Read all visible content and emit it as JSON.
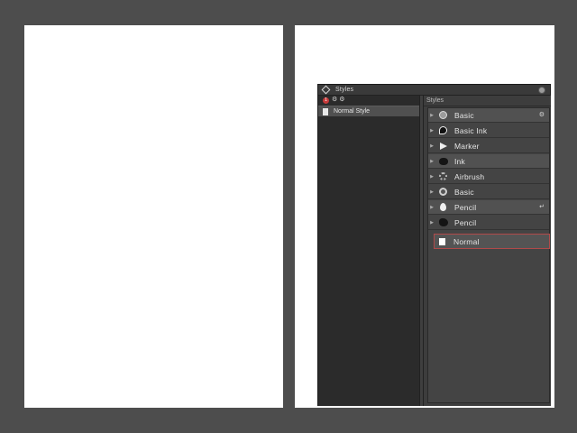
{
  "panel": {
    "title": "Styles",
    "toolbar": {
      "badge": "1",
      "tools": "⚙ ⚙"
    },
    "left_items": [
      {
        "label": "Normal Style"
      }
    ],
    "right_header": "Styles",
    "items": [
      {
        "label": "Basic",
        "icon": "circle-icon",
        "trail": "⚙"
      },
      {
        "label": "Basic Ink",
        "icon": "ink-blob-icon"
      },
      {
        "label": "Marker",
        "icon": "marker-icon"
      },
      {
        "label": "Ink",
        "icon": "ink-icon"
      },
      {
        "label": "Airbrush",
        "icon": "airbrush-icon"
      },
      {
        "label": "Basic",
        "icon": "ring-icon"
      },
      {
        "label": "Pencil",
        "icon": "pencil-icon",
        "trail": "↵"
      },
      {
        "label": "Pencil",
        "icon": "pencil-dark-icon"
      },
      {
        "label": "Normal",
        "icon": "paper-icon"
      }
    ]
  }
}
